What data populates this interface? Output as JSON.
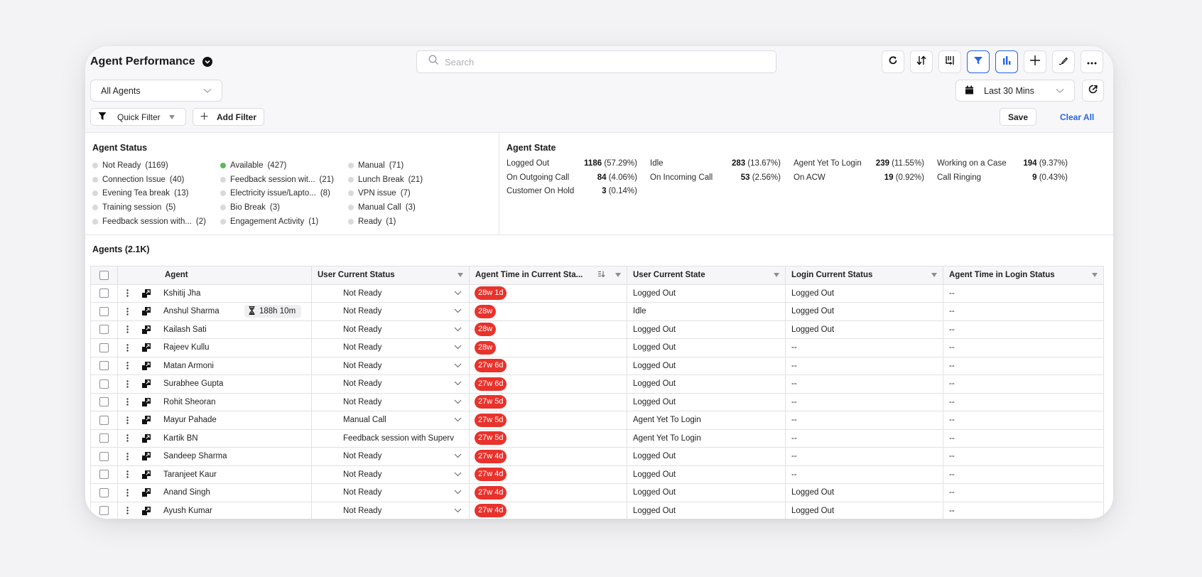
{
  "header": {
    "title": "Agent Performance",
    "search_placeholder": "Search",
    "toolbar": [
      {
        "icon": "refresh-icon",
        "active": false
      },
      {
        "icon": "sort-icon",
        "active": false
      },
      {
        "icon": "columns-icon",
        "active": false
      },
      {
        "icon": "filter-icon",
        "active": true
      },
      {
        "icon": "bar-chart-icon",
        "active": true
      },
      {
        "icon": "plus-icon",
        "active": false
      },
      {
        "icon": "pen-icon",
        "active": false
      },
      {
        "icon": "more-icon",
        "active": false
      }
    ]
  },
  "filters": {
    "agent_scope": "All Agents",
    "quick_filter_label": "Quick Filter",
    "add_filter_label": "Add Filter",
    "date_range": "Last 30 Mins",
    "save_label": "Save",
    "clear_all_label": "Clear All"
  },
  "agent_status": {
    "title": "Agent Status",
    "columns": [
      [
        {
          "label": "Not Ready",
          "count": "(1169)",
          "color": "#d9d9dc"
        },
        {
          "label": "Connection Issue",
          "count": "(40)",
          "color": "#d9d9dc"
        },
        {
          "label": "Evening Tea break",
          "count": "(13)",
          "color": "#d9d9dc"
        },
        {
          "label": "Training session",
          "count": "(5)",
          "color": "#d9d9dc"
        },
        {
          "label": "Feedback session with...",
          "count": "(2)",
          "color": "#d9d9dc"
        }
      ],
      [
        {
          "label": "Available",
          "count": "(427)",
          "color": "#5cb85c"
        },
        {
          "label": "Feedback session wit...",
          "count": "(21)",
          "color": "#d9d9dc"
        },
        {
          "label": "Electricity issue/Lapto...",
          "count": "(8)",
          "color": "#d9d9dc"
        },
        {
          "label": "Bio Break",
          "count": "(3)",
          "color": "#d9d9dc"
        },
        {
          "label": "Engagement Activity",
          "count": "(1)",
          "color": "#d9d9dc"
        }
      ],
      [
        {
          "label": "Manual",
          "count": "(71)",
          "color": "#d9d9dc"
        },
        {
          "label": "Lunch Break",
          "count": "(21)",
          "color": "#d9d9dc"
        },
        {
          "label": "VPN issue",
          "count": "(7)",
          "color": "#d9d9dc"
        },
        {
          "label": "Manual Call",
          "count": "(3)",
          "color": "#d9d9dc"
        },
        {
          "label": "Ready",
          "count": "(1)",
          "color": "#d9d9dc"
        }
      ]
    ]
  },
  "agent_state": {
    "title": "Agent State",
    "columns": [
      [
        {
          "label": "Logged Out",
          "value": "1186",
          "pct": "(57.29%)"
        },
        {
          "label": "On Outgoing Call",
          "value": "84",
          "pct": "(4.06%)"
        },
        {
          "label": "Customer On Hold",
          "value": "3",
          "pct": "(0.14%)"
        }
      ],
      [
        {
          "label": "Idle",
          "value": "283",
          "pct": "(13.67%)"
        },
        {
          "label": "On Incoming Call",
          "value": "53",
          "pct": "(2.56%)"
        }
      ],
      [
        {
          "label": "Agent Yet To Login",
          "value": "239",
          "pct": "(11.55%)"
        },
        {
          "label": "On ACW",
          "value": "19",
          "pct": "(0.92%)"
        }
      ],
      [
        {
          "label": "Working on a Case",
          "value": "194",
          "pct": "(9.37%)"
        },
        {
          "label": "Call Ringing",
          "value": "9",
          "pct": "(0.43%)"
        }
      ]
    ]
  },
  "agents_table": {
    "title": "Agents (2.1K)",
    "columns": [
      "Agent",
      "User Current Status",
      "Agent Time in Current Sta...",
      "User Current State",
      "Login Current Status",
      "Agent Time in Login Status"
    ],
    "rows": [
      {
        "agent": "Kshitij Jha",
        "timer": "",
        "status": "Not Ready",
        "status_dropdown": true,
        "time": "28w 1d",
        "state": "Logged Out",
        "login_status": "Logged Out",
        "login_time": "--"
      },
      {
        "agent": "Anshul Sharma",
        "timer": "188h 10m",
        "status": "Not Ready",
        "status_dropdown": true,
        "time": "28w",
        "state": "Idle",
        "login_status": "Logged Out",
        "login_time": "--"
      },
      {
        "agent": "Kailash Sati",
        "timer": "",
        "status": "Not Ready",
        "status_dropdown": true,
        "time": "28w",
        "state": "Logged Out",
        "login_status": "Logged Out",
        "login_time": "--"
      },
      {
        "agent": "Rajeev Kullu",
        "timer": "",
        "status": "Not Ready",
        "status_dropdown": true,
        "time": "28w",
        "state": "Logged Out",
        "login_status": "--",
        "login_time": "--"
      },
      {
        "agent": "Matan Armoni",
        "timer": "",
        "status": "Not Ready",
        "status_dropdown": true,
        "time": "27w 6d",
        "state": "Logged Out",
        "login_status": "--",
        "login_time": "--"
      },
      {
        "agent": "Surabhee Gupta",
        "timer": "",
        "status": "Not Ready",
        "status_dropdown": true,
        "time": "27w 6d",
        "state": "Logged Out",
        "login_status": "--",
        "login_time": "--"
      },
      {
        "agent": "Rohit Sheoran",
        "timer": "",
        "status": "Not Ready",
        "status_dropdown": true,
        "time": "27w 5d",
        "state": "Logged Out",
        "login_status": "--",
        "login_time": "--"
      },
      {
        "agent": "Mayur Pahade",
        "timer": "",
        "status": "Manual Call",
        "status_dropdown": true,
        "time": "27w 5d",
        "state": "Agent Yet To Login",
        "login_status": "--",
        "login_time": "--"
      },
      {
        "agent": "Kartik BN",
        "timer": "",
        "status": "Feedback session with Superv",
        "status_dropdown": false,
        "time": "27w 5d",
        "state": "Agent Yet To Login",
        "login_status": "--",
        "login_time": "--"
      },
      {
        "agent": "Sandeep Sharma",
        "timer": "",
        "status": "Not Ready",
        "status_dropdown": true,
        "time": "27w 4d",
        "state": "Logged Out",
        "login_status": "--",
        "login_time": "--"
      },
      {
        "agent": "Taranjeet Kaur",
        "timer": "",
        "status": "Not Ready",
        "status_dropdown": true,
        "time": "27w 4d",
        "state": "Logged Out",
        "login_status": "--",
        "login_time": "--"
      },
      {
        "agent": "Anand Singh",
        "timer": "",
        "status": "Not Ready",
        "status_dropdown": true,
        "time": "27w 4d",
        "state": "Logged Out",
        "login_status": "Logged Out",
        "login_time": "--"
      },
      {
        "agent": "Ayush Kumar",
        "timer": "",
        "status": "Not Ready",
        "status_dropdown": true,
        "time": "27w 4d",
        "state": "Logged Out",
        "login_status": "Logged Out",
        "login_time": "--"
      }
    ]
  },
  "colors": {
    "accent": "#2563eb",
    "badge_red": "#e8322b",
    "available_green": "#5cb85c"
  }
}
